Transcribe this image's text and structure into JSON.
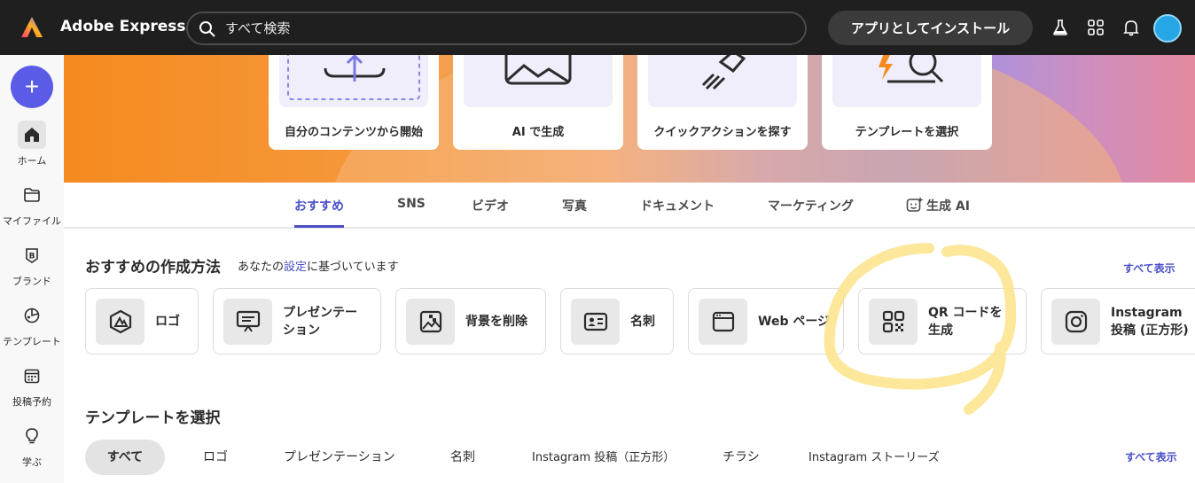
{
  "app": {
    "name": "Adobe Express"
  },
  "search": {
    "placeholder": "すべて検索"
  },
  "header": {
    "install_label": "アプリとしてインストール",
    "icons": [
      "flask-icon",
      "apps-grid-icon",
      "bell-icon",
      "avatar"
    ]
  },
  "sidebar": {
    "create_label": "+",
    "items": [
      {
        "label": "ホーム",
        "icon": "home-icon",
        "active": true
      },
      {
        "label": "マイファイル",
        "icon": "folder-icon"
      },
      {
        "label": "ブランド",
        "icon": "brand-icon"
      },
      {
        "label": "テンプレート",
        "icon": "template-icon"
      },
      {
        "label": "投稿予約",
        "icon": "calendar-icon"
      },
      {
        "label": "学ぶ",
        "icon": "bulb-icon"
      }
    ]
  },
  "hero": {
    "cards": [
      {
        "label": "自分のコンテンツから開始",
        "icon": "upload-icon"
      },
      {
        "label": "AI で生成",
        "icon": "image-icon"
      },
      {
        "label": "クイックアクションを探す",
        "icon": "rocket-icon"
      },
      {
        "label": "テンプレートを選択",
        "icon": "search-template-icon"
      }
    ]
  },
  "tabs": {
    "items": [
      "おすすめ",
      "SNS",
      "ビデオ",
      "写真",
      "ドキュメント",
      "マーケティング",
      "生成 AI"
    ],
    "active": "おすすめ"
  },
  "recommended": {
    "title": "おすすめの作成方法",
    "subtitle_prefix": "あなたの",
    "subtitle_link": "設定",
    "subtitle_suffix": "に基づいています",
    "see_all": "すべて表示",
    "cards": [
      {
        "label": "ロゴ",
        "icon": "logo-icon"
      },
      {
        "label": "プレゼンテー\nション",
        "icon": "presentation-icon"
      },
      {
        "label": "背景を削除",
        "icon": "remove-background-icon"
      },
      {
        "label": "名刺",
        "icon": "business-card-icon"
      },
      {
        "label": "Web ページ",
        "icon": "webpage-icon"
      },
      {
        "label": "QR コードを\n生成",
        "icon": "qr-code-icon"
      },
      {
        "label": "Instagram\n投稿 (正方形)",
        "icon": "instagram-icon"
      }
    ]
  },
  "templates": {
    "title": "テンプレートを選択",
    "see_all": "すべて表示",
    "pills": [
      "すべて",
      "ロゴ",
      "プレゼンテーション",
      "名刺",
      "Instagram 投稿（正方形）",
      "チラシ",
      "Instagram ストーリーズ"
    ],
    "active": "すべて"
  },
  "colors": {
    "accent": "#4a4fc9",
    "create_button": "#5a5ce8",
    "topbar": "#1f1f1f",
    "highlight": "#fbe38a"
  }
}
